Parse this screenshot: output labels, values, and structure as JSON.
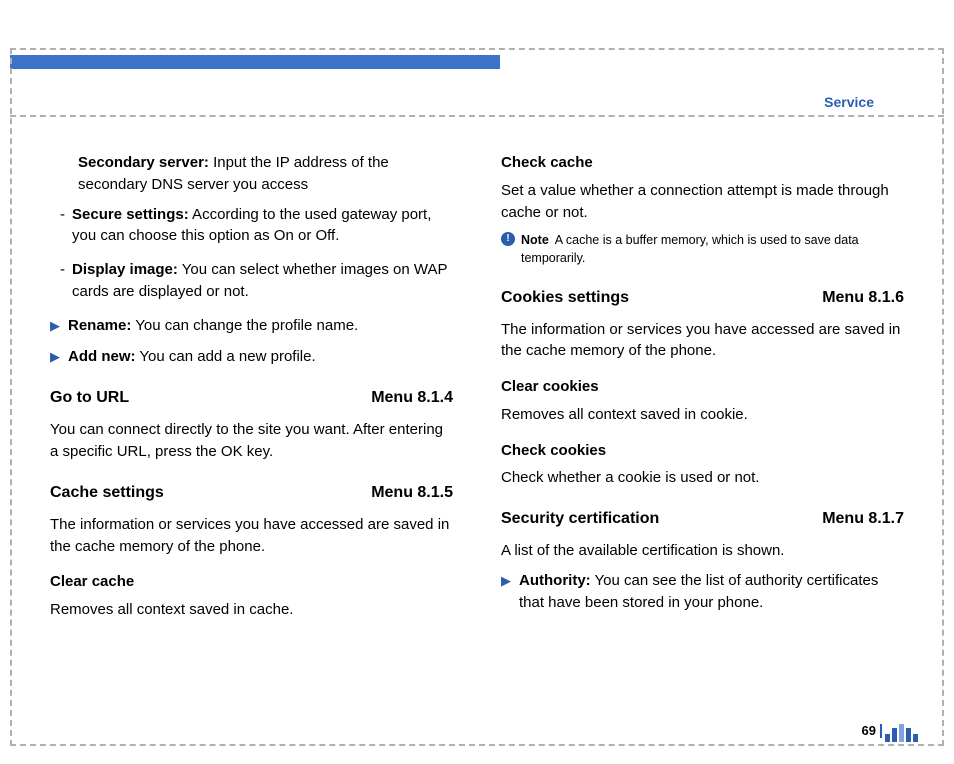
{
  "header": {
    "section": "Service"
  },
  "left": {
    "secondary_server_label": "Secondary server:",
    "secondary_server_text": " Input the IP address of the secondary DNS server you access",
    "secure_settings_label": "Secure settings:",
    "secure_settings_text": " According to the used gateway port, you can choose this option as On or Off.",
    "display_image_label": "Display image:",
    "display_image_text": " You can select whether images on WAP cards are displayed or not.",
    "rename_label": "Rename:",
    "rename_text": " You can change the profile name.",
    "addnew_label": "Add new:",
    "addnew_text": " You can add a new profile.",
    "goto_url_title": "Go to URL",
    "goto_url_menu": "Menu 8.1.4",
    "goto_url_text": "You can connect directly to the site you want. After entering a specific URL, press the OK key.",
    "cache_settings_title": "Cache settings",
    "cache_settings_menu": "Menu 8.1.5",
    "cache_settings_text": "The information or services you have accessed are saved in the cache memory of the phone.",
    "clear_cache_title": "Clear cache",
    "clear_cache_text": "Removes all context saved in cache."
  },
  "right": {
    "check_cache_title": "Check cache",
    "check_cache_text": "Set a value whether a connection attempt is made through cache or not.",
    "note_label": "Note",
    "note_text": "A cache is a buffer memory, which is used to save data temporarily.",
    "cookies_title": "Cookies settings",
    "cookies_menu": "Menu 8.1.6",
    "cookies_text": "The information or services you have accessed are saved in the cache memory of the phone.",
    "clear_cookies_title": "Clear cookies",
    "clear_cookies_text": "Removes all context saved in cookie.",
    "check_cookies_title": "Check cookies",
    "check_cookies_text": "Check whether a cookie is used or not.",
    "security_title": "Security certification",
    "security_menu": "Menu 8.1.7",
    "security_text": "A list of the available certification is shown.",
    "authority_label": "Authority:",
    "authority_text": " You can see the list of authority certificates that have been stored in your phone."
  },
  "footer": {
    "page": "69"
  }
}
